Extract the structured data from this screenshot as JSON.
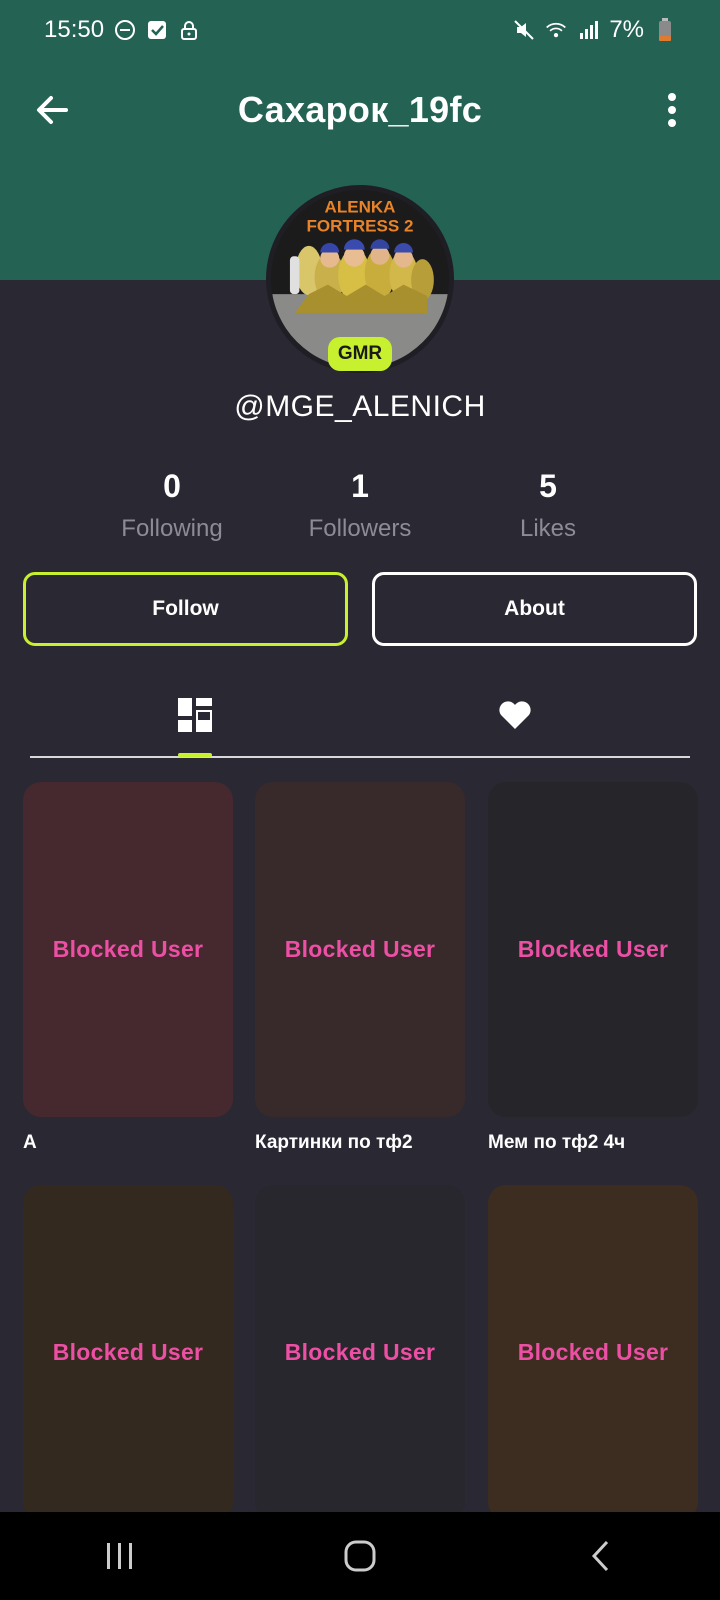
{
  "status_bar": {
    "time": "15:50",
    "battery": "7%",
    "icons_left": [
      "do-not-disturb-icon",
      "check-icon",
      "lock-icon"
    ],
    "icons_right": [
      "mute-icon",
      "wifi-icon",
      "signal-icon",
      "battery-icon"
    ]
  },
  "header": {
    "title": "Сахарок_19fc",
    "background_color": "#246253"
  },
  "profile": {
    "avatar_text_line1": "ALENKA",
    "avatar_text_line2": "FORTRESS 2",
    "badge": "GMR",
    "username": "@MGE_ALENICH"
  },
  "stats": [
    {
      "value": "0",
      "label": "Following"
    },
    {
      "value": "1",
      "label": "Followers"
    },
    {
      "value": "5",
      "label": "Likes"
    }
  ],
  "buttons": {
    "follow": "Follow",
    "about": "About"
  },
  "tabs": {
    "items": [
      "grid-icon",
      "heart-icon"
    ],
    "active": "grid-icon",
    "accent_color": "#c7f02f"
  },
  "cards": [
    {
      "overlay": "Blocked User",
      "caption": "A",
      "color": "#46292f"
    },
    {
      "overlay": "Blocked User",
      "caption": "Картинки по тф2",
      "color": "#38292a"
    },
    {
      "overlay": "Blocked User",
      "caption": "Мем по тф2 4ч",
      "color": "#26252a"
    },
    {
      "overlay": "Blocked User",
      "caption": "",
      "color": "#33291f"
    },
    {
      "overlay": "Blocked User",
      "caption": "",
      "color": "#28272d"
    },
    {
      "overlay": "Blocked User",
      "caption": "",
      "color": "#3c2d20"
    }
  ],
  "nav": [
    "recents-icon",
    "home-icon",
    "back-icon"
  ]
}
